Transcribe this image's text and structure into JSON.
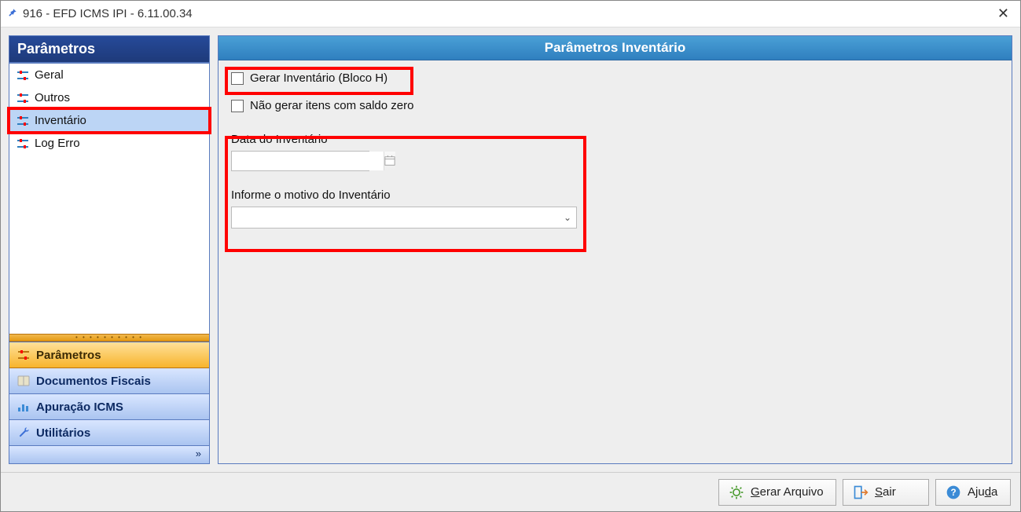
{
  "window": {
    "title": "916 - EFD ICMS IPI - 6.11.00.34"
  },
  "sidebar": {
    "title": "Parâmetros",
    "items": [
      {
        "label": "Geral"
      },
      {
        "label": "Outros"
      },
      {
        "label": "Inventário"
      },
      {
        "label": "Log Erro"
      }
    ]
  },
  "accordion": [
    {
      "label": "Parâmetros",
      "active": true,
      "icon": "sliders-icon"
    },
    {
      "label": "Documentos Fiscais",
      "active": false,
      "icon": "book-icon"
    },
    {
      "label": "Apuração ICMS",
      "active": false,
      "icon": "chart-icon"
    },
    {
      "label": "Utilitários",
      "active": false,
      "icon": "wrench-icon"
    }
  ],
  "content": {
    "title": "Parâmetros Inventário",
    "checkbox1_label": "Gerar Inventário (Bloco H)",
    "checkbox2_label": "Não gerar itens com saldo zero",
    "date_label": "Data do Inventário",
    "date_value": "",
    "reason_label": "Informe o motivo do Inventário",
    "reason_value": ""
  },
  "footer": {
    "btn_generate": "Gerar Arquivo",
    "btn_exit_prefix": "S",
    "btn_exit_rest": "air",
    "btn_help_prefix": "Aju",
    "btn_help_u": "d",
    "btn_help_rest": "a"
  }
}
